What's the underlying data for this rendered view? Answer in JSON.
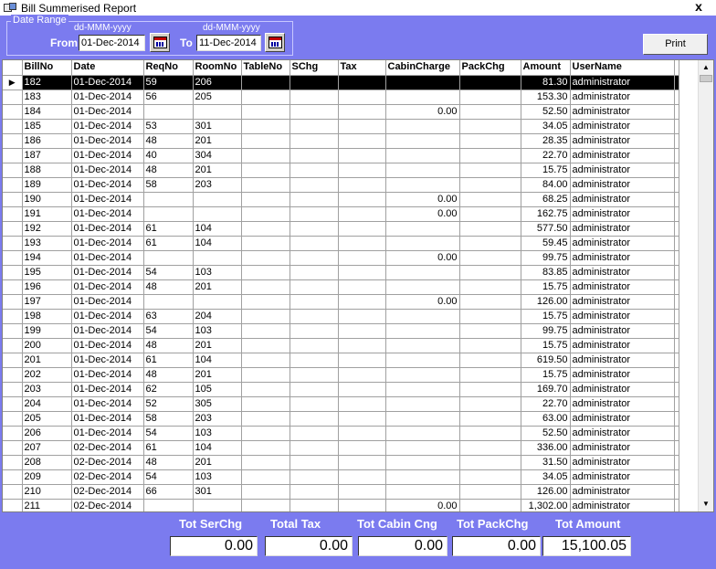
{
  "window": {
    "title": "Bill Summerised Report",
    "close_label": "x"
  },
  "date_range": {
    "legend": "Date Range",
    "format_hint_from": "dd-MMM-yyyy",
    "format_hint_to": "dd-MMM-yyyy",
    "from_label": "From",
    "from_value": "01-Dec-2014",
    "to_label": "To",
    "to_value": "11-Dec-2014"
  },
  "print_label": "Print",
  "table": {
    "columns": [
      "BillNo",
      "Date",
      "ReqNo",
      "RoomNo",
      "TableNo",
      "SChg",
      "Tax",
      "CabinCharge",
      "PackChg",
      "Amount",
      "UserName"
    ],
    "rows": [
      [
        "182",
        "01-Dec-2014",
        "59",
        "206",
        "",
        "",
        "",
        "",
        "",
        "81.30",
        "administrator"
      ],
      [
        "183",
        "01-Dec-2014",
        "56",
        "205",
        "",
        "",
        "",
        "",
        "",
        "153.30",
        "administrator"
      ],
      [
        "184",
        "01-Dec-2014",
        "",
        "",
        "",
        "",
        "",
        "0.00",
        "",
        "52.50",
        "administrator"
      ],
      [
        "185",
        "01-Dec-2014",
        "53",
        "301",
        "",
        "",
        "",
        "",
        "",
        "34.05",
        "administrator"
      ],
      [
        "186",
        "01-Dec-2014",
        "48",
        "201",
        "",
        "",
        "",
        "",
        "",
        "28.35",
        "administrator"
      ],
      [
        "187",
        "01-Dec-2014",
        "40",
        "304",
        "",
        "",
        "",
        "",
        "",
        "22.70",
        "administrator"
      ],
      [
        "188",
        "01-Dec-2014",
        "48",
        "201",
        "",
        "",
        "",
        "",
        "",
        "15.75",
        "administrator"
      ],
      [
        "189",
        "01-Dec-2014",
        "58",
        "203",
        "",
        "",
        "",
        "",
        "",
        "84.00",
        "administrator"
      ],
      [
        "190",
        "01-Dec-2014",
        "",
        "",
        "",
        "",
        "",
        "0.00",
        "",
        "68.25",
        "administrator"
      ],
      [
        "191",
        "01-Dec-2014",
        "",
        "",
        "",
        "",
        "",
        "0.00",
        "",
        "162.75",
        "administrator"
      ],
      [
        "192",
        "01-Dec-2014",
        "61",
        "104",
        "",
        "",
        "",
        "",
        "",
        "577.50",
        "administrator"
      ],
      [
        "193",
        "01-Dec-2014",
        "61",
        "104",
        "",
        "",
        "",
        "",
        "",
        "59.45",
        "administrator"
      ],
      [
        "194",
        "01-Dec-2014",
        "",
        "",
        "",
        "",
        "",
        "0.00",
        "",
        "99.75",
        "administrator"
      ],
      [
        "195",
        "01-Dec-2014",
        "54",
        "103",
        "",
        "",
        "",
        "",
        "",
        "83.85",
        "administrator"
      ],
      [
        "196",
        "01-Dec-2014",
        "48",
        "201",
        "",
        "",
        "",
        "",
        "",
        "15.75",
        "administrator"
      ],
      [
        "197",
        "01-Dec-2014",
        "",
        "",
        "",
        "",
        "",
        "0.00",
        "",
        "126.00",
        "administrator"
      ],
      [
        "198",
        "01-Dec-2014",
        "63",
        "204",
        "",
        "",
        "",
        "",
        "",
        "15.75",
        "administrator"
      ],
      [
        "199",
        "01-Dec-2014",
        "54",
        "103",
        "",
        "",
        "",
        "",
        "",
        "99.75",
        "administrator"
      ],
      [
        "200",
        "01-Dec-2014",
        "48",
        "201",
        "",
        "",
        "",
        "",
        "",
        "15.75",
        "administrator"
      ],
      [
        "201",
        "01-Dec-2014",
        "61",
        "104",
        "",
        "",
        "",
        "",
        "",
        "619.50",
        "administrator"
      ],
      [
        "202",
        "01-Dec-2014",
        "48",
        "201",
        "",
        "",
        "",
        "",
        "",
        "15.75",
        "administrator"
      ],
      [
        "203",
        "01-Dec-2014",
        "62",
        "105",
        "",
        "",
        "",
        "",
        "",
        "169.70",
        "administrator"
      ],
      [
        "204",
        "01-Dec-2014",
        "52",
        "305",
        "",
        "",
        "",
        "",
        "",
        "22.70",
        "administrator"
      ],
      [
        "205",
        "01-Dec-2014",
        "58",
        "203",
        "",
        "",
        "",
        "",
        "",
        "63.00",
        "administrator"
      ],
      [
        "206",
        "01-Dec-2014",
        "54",
        "103",
        "",
        "",
        "",
        "",
        "",
        "52.50",
        "administrator"
      ],
      [
        "207",
        "02-Dec-2014",
        "61",
        "104",
        "",
        "",
        "",
        "",
        "",
        "336.00",
        "administrator"
      ],
      [
        "208",
        "02-Dec-2014",
        "48",
        "201",
        "",
        "",
        "",
        "",
        "",
        "31.50",
        "administrator"
      ],
      [
        "209",
        "02-Dec-2014",
        "54",
        "103",
        "",
        "",
        "",
        "",
        "",
        "34.05",
        "administrator"
      ],
      [
        "210",
        "02-Dec-2014",
        "66",
        "301",
        "",
        "",
        "",
        "",
        "",
        "126.00",
        "administrator"
      ],
      [
        "211",
        "02-Dec-2014",
        "",
        "",
        "",
        "",
        "",
        "0.00",
        "",
        "1,302.00",
        "administrator"
      ]
    ],
    "selected_row": 0
  },
  "totals": {
    "serchg_label": "Tot SerChg",
    "serchg_value": "0.00",
    "tax_label": "Total Tax",
    "tax_value": "0.00",
    "cabin_label": "Tot Cabin Cng",
    "cabin_value": "0.00",
    "pack_label": "Tot PackChg",
    "pack_value": "0.00",
    "amount_label": "Tot Amount",
    "amount_value": "15,100.05"
  },
  "colors": {
    "background": "#7b7bef",
    "grid": "#ffffff",
    "selected_row": "#000000"
  }
}
